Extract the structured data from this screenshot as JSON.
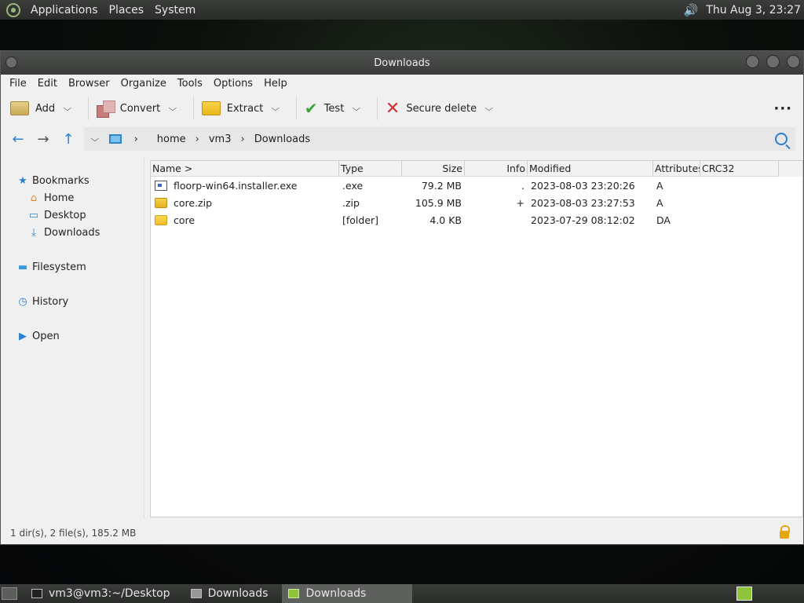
{
  "top_panel": {
    "menus": [
      "Applications",
      "Places",
      "System"
    ],
    "clock": "Thu Aug  3, 23:27"
  },
  "window": {
    "title": "Downloads",
    "menubar": [
      "File",
      "Edit",
      "Browser",
      "Organize",
      "Tools",
      "Options",
      "Help"
    ],
    "toolbar": {
      "add": "Add",
      "convert": "Convert",
      "extract": "Extract",
      "test": "Test",
      "secure_delete": "Secure delete",
      "more": "···"
    },
    "breadcrumb": [
      "home",
      "vm3",
      "Downloads"
    ],
    "sidebar": {
      "bookmarks": "Bookmarks",
      "bookmark_items": [
        "Home",
        "Desktop",
        "Downloads"
      ],
      "filesystem": "Filesystem",
      "history": "History",
      "open": "Open"
    },
    "columns": [
      "Name >",
      "Type",
      "Size",
      "Info",
      "Modified",
      "Attributes",
      "CRC32"
    ],
    "files": [
      {
        "name": "floorp-win64.installer.exe",
        "type": ".exe",
        "size": "79.2 MB",
        "info": ".",
        "modified": "2023-08-03 23:20:26",
        "attributes": "A",
        "crc32": "",
        "icon": "exe-icon"
      },
      {
        "name": "core.zip",
        "type": ".zip",
        "size": "105.9 MB",
        "info": "+",
        "modified": "2023-08-03 23:27:53",
        "attributes": "A",
        "crc32": "",
        "icon": "zip-icon"
      },
      {
        "name": "core",
        "type": "[folder]",
        "size": "4.0 KB",
        "info": "",
        "modified": "2023-07-29 08:12:02",
        "attributes": "DA",
        "crc32": "",
        "icon": "folder-icon"
      }
    ],
    "status": "1 dir(s), 2 file(s), 185.2 MB"
  },
  "taskbar": {
    "tasks": [
      {
        "label": "vm3@vm3:~/Desktop"
      },
      {
        "label": "Downloads"
      },
      {
        "label": "Downloads"
      }
    ]
  }
}
